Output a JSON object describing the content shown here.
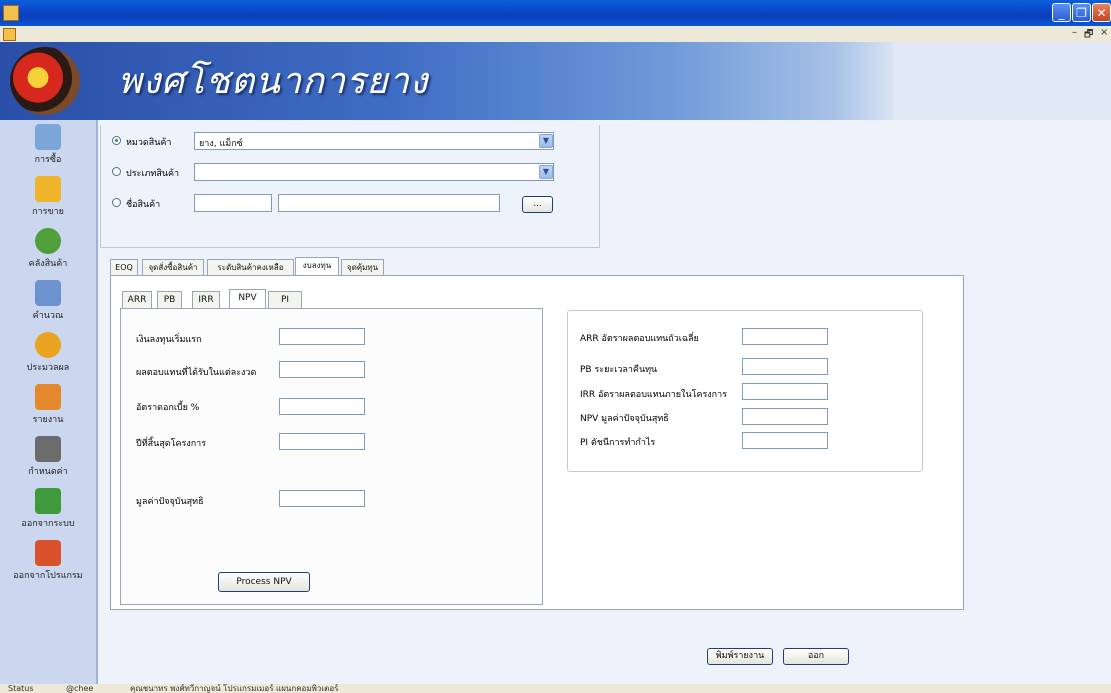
{
  "window": {
    "title": "",
    "controls": {
      "minimize": "_",
      "restore": "❐",
      "close": "✕"
    },
    "mdi_controls": {
      "minimize": "–",
      "restore": "🗗",
      "close": "×"
    }
  },
  "banner": {
    "title": "พงศโชตนาการยาง"
  },
  "sidebar": {
    "items": [
      {
        "label": "การซื้อ",
        "icon": "document-folder-icon",
        "color": "#7aa6d8"
      },
      {
        "label": "การขาย",
        "icon": "envelope-icon",
        "color": "#f0b42a"
      },
      {
        "label": "คลังสินค้า",
        "icon": "people-icon",
        "color": "#4fa03a"
      },
      {
        "label": "คำนวณ",
        "icon": "calculator-icon",
        "color": "#6d93cf"
      },
      {
        "label": "ประมวลผล",
        "icon": "clock-process-icon",
        "color": "#e9a321"
      },
      {
        "label": "รายงาน",
        "icon": "report-pencil-icon",
        "color": "#e48a2c"
      },
      {
        "label": "กำหนดค่า",
        "icon": "tools-icon",
        "color": "#6c6c6c"
      },
      {
        "label": "ออกจากระบบ",
        "icon": "logout-door-icon",
        "color": "#3f9a3b"
      },
      {
        "label": "ออกจากโปรแกรม",
        "icon": "house-exit-icon",
        "color": "#d8512b"
      }
    ]
  },
  "filter": {
    "category": {
      "label": "หมวดสินค้า",
      "value": "ยาง, แม็กซ์",
      "selected": true
    },
    "type": {
      "label": "ประเภทสินค้า",
      "value": "",
      "selected": false
    },
    "product": {
      "label": "ชื่อสินค้า",
      "code": "",
      "name": "",
      "browse_label": "...",
      "selected": false
    }
  },
  "tabs": [
    {
      "label": "EOQ",
      "active": false
    },
    {
      "label": "จุดสั่งซื้อสินค้า",
      "active": false
    },
    {
      "label": "ระดับสินค้าคงเหลือ",
      "active": false
    },
    {
      "label": "งบลงทุน",
      "active": true
    },
    {
      "label": "จุดคุ้มทุน",
      "active": false
    }
  ],
  "subtabs": [
    {
      "label": "ARR",
      "active": false
    },
    {
      "label": "PB",
      "active": false
    },
    {
      "label": "IRR",
      "active": false
    },
    {
      "label": "NPV",
      "active": true
    },
    {
      "label": "PI",
      "active": false
    }
  ],
  "npv_form": {
    "initial_investment": {
      "label": "เงินลงทุนเริ่มแรก",
      "value": ""
    },
    "period_return": {
      "label": "ผลตอบแทนที่ได้รับในแต่ละงวด",
      "value": ""
    },
    "interest_rate": {
      "label": "อัตราดอกเบี้ย %",
      "value": ""
    },
    "project_end_year": {
      "label": "ปีที่สิ้นสุดโครงการ",
      "value": ""
    },
    "net_present_value": {
      "label": "มูลค่าปัจจุบันสุทธิ",
      "value": ""
    },
    "process_button": "Process NPV"
  },
  "summary": {
    "arr": {
      "label": "ARR อัตราผลตอบแทนถัวเฉลี่ย",
      "value": ""
    },
    "pb": {
      "label": "PB ระยะเวลาคืนทุน",
      "value": ""
    },
    "irr": {
      "label": "IRR อัตราผลตอบแทนภายในโครงการ",
      "value": ""
    },
    "npv": {
      "label": "NPV มูลค่าปัจจุบันสุทธิ",
      "value": ""
    },
    "pi": {
      "label": "PI ดัชนีการทำกำไร",
      "value": ""
    }
  },
  "actions": {
    "print_label": "พิมพ์รายงาน",
    "exit_label": "ออก"
  },
  "statusbar": {
    "status": "Status",
    "user": "@chee",
    "credit": "คุณชนาทร พงศ์ทวีกาญจน์ โปรแกรมเมอร์ แผนกคอมพิวเตอร์"
  }
}
